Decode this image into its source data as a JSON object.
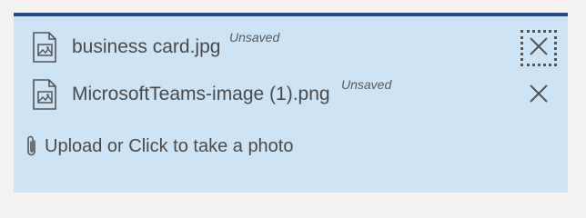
{
  "attachments": {
    "files": [
      {
        "name": "business card.jpg",
        "status": "Unsaved",
        "icon": "image-file-icon",
        "remove_icon": "close-icon"
      },
      {
        "name": "MicrosoftTeams-image (1).png",
        "status": "Unsaved",
        "icon": "image-file-icon",
        "remove_icon": "close-icon"
      }
    ],
    "upload_label": "Upload or Click to take a photo",
    "upload_icon": "paperclip-icon"
  },
  "colors": {
    "panel_background": "#cce4f6",
    "panel_top_border": "#1e4e8c",
    "page_background": "#f3f2f1",
    "text": "#4a4a4a"
  }
}
